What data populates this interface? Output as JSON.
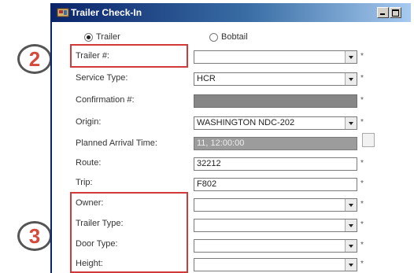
{
  "window": {
    "title": "Trailer Check-In"
  },
  "radios": [
    {
      "label": "Trailer",
      "checked": true
    },
    {
      "label": "Bobtail",
      "checked": false
    }
  ],
  "fields": [
    {
      "label": "Trailer #:",
      "value": "",
      "control": "dropdown",
      "required_mark": "*"
    },
    {
      "label": "Service Type:",
      "value": "HCR",
      "control": "dropdown",
      "required_mark": "*"
    },
    {
      "label": "Confirmation #:",
      "value": "",
      "control": "readonly",
      "required_mark": "*"
    },
    {
      "label": "Origin:",
      "value": "WASHINGTON NDC-202",
      "control": "dropdown",
      "required_mark": "*"
    },
    {
      "label": "Planned Arrival Time:",
      "value": "11, 12:00:00",
      "control": "readonly-blurred",
      "required_mark": ""
    },
    {
      "label": "Route:",
      "value": "32212",
      "control": "text",
      "required_mark": "*"
    },
    {
      "label": "Trip:",
      "value": "F802",
      "control": "text",
      "required_mark": "*"
    },
    {
      "label": "Owner:",
      "value": "",
      "control": "dropdown",
      "required_mark": "*"
    },
    {
      "label": "Trailer Type:",
      "value": "",
      "control": "dropdown",
      "required_mark": "*"
    },
    {
      "label": "Door Type:",
      "value": "",
      "control": "dropdown",
      "required_mark": "*"
    },
    {
      "label": "Height:",
      "value": "",
      "control": "dropdown",
      "required_mark": "*"
    }
  ],
  "annotations": {
    "badge_2": "2",
    "badge_3": "3",
    "highlight_color": "#d23a3a"
  },
  "colors": {
    "titlebar": "#0a246a",
    "readonly_field": "#868686"
  }
}
